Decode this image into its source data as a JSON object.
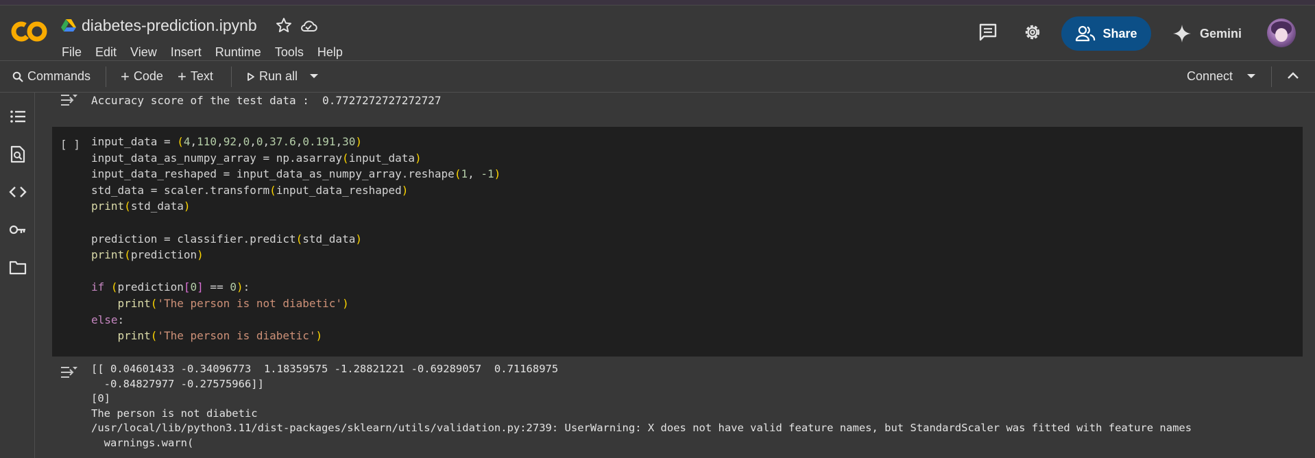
{
  "header": {
    "notebook_title": "diabetes-prediction.ipynb",
    "menu": [
      "File",
      "Edit",
      "View",
      "Insert",
      "Runtime",
      "Tools",
      "Help"
    ],
    "share_label": "Share",
    "gemini_label": "Gemini",
    "brand_color": "#f9ab00"
  },
  "toolbar": {
    "commands_label": "Commands",
    "code_label": "Code",
    "text_label": "Text",
    "run_all_label": "Run all",
    "connect_label": "Connect"
  },
  "sidebar": {
    "icons": [
      "table-of-contents-icon",
      "find-icon",
      "code-snippets-icon",
      "secrets-key-icon",
      "files-folder-icon"
    ]
  },
  "cells": {
    "prev_output": "Accuracy score of the test data :  0.7727272727272727",
    "cell_bracket": "[ ]",
    "output_lines": [
      "[[ 0.04601433 -0.34096773  1.18359575 -1.28821221 -0.69289057  0.71168975",
      "  -0.84827977 -0.27575966]]",
      "[0]",
      "The person is not diabetic",
      "/usr/local/lib/python3.11/dist-packages/sklearn/utils/validation.py:2739: UserWarning: X does not have valid feature names, but StandardScaler was fitted with feature names",
      "  warnings.warn("
    ]
  }
}
